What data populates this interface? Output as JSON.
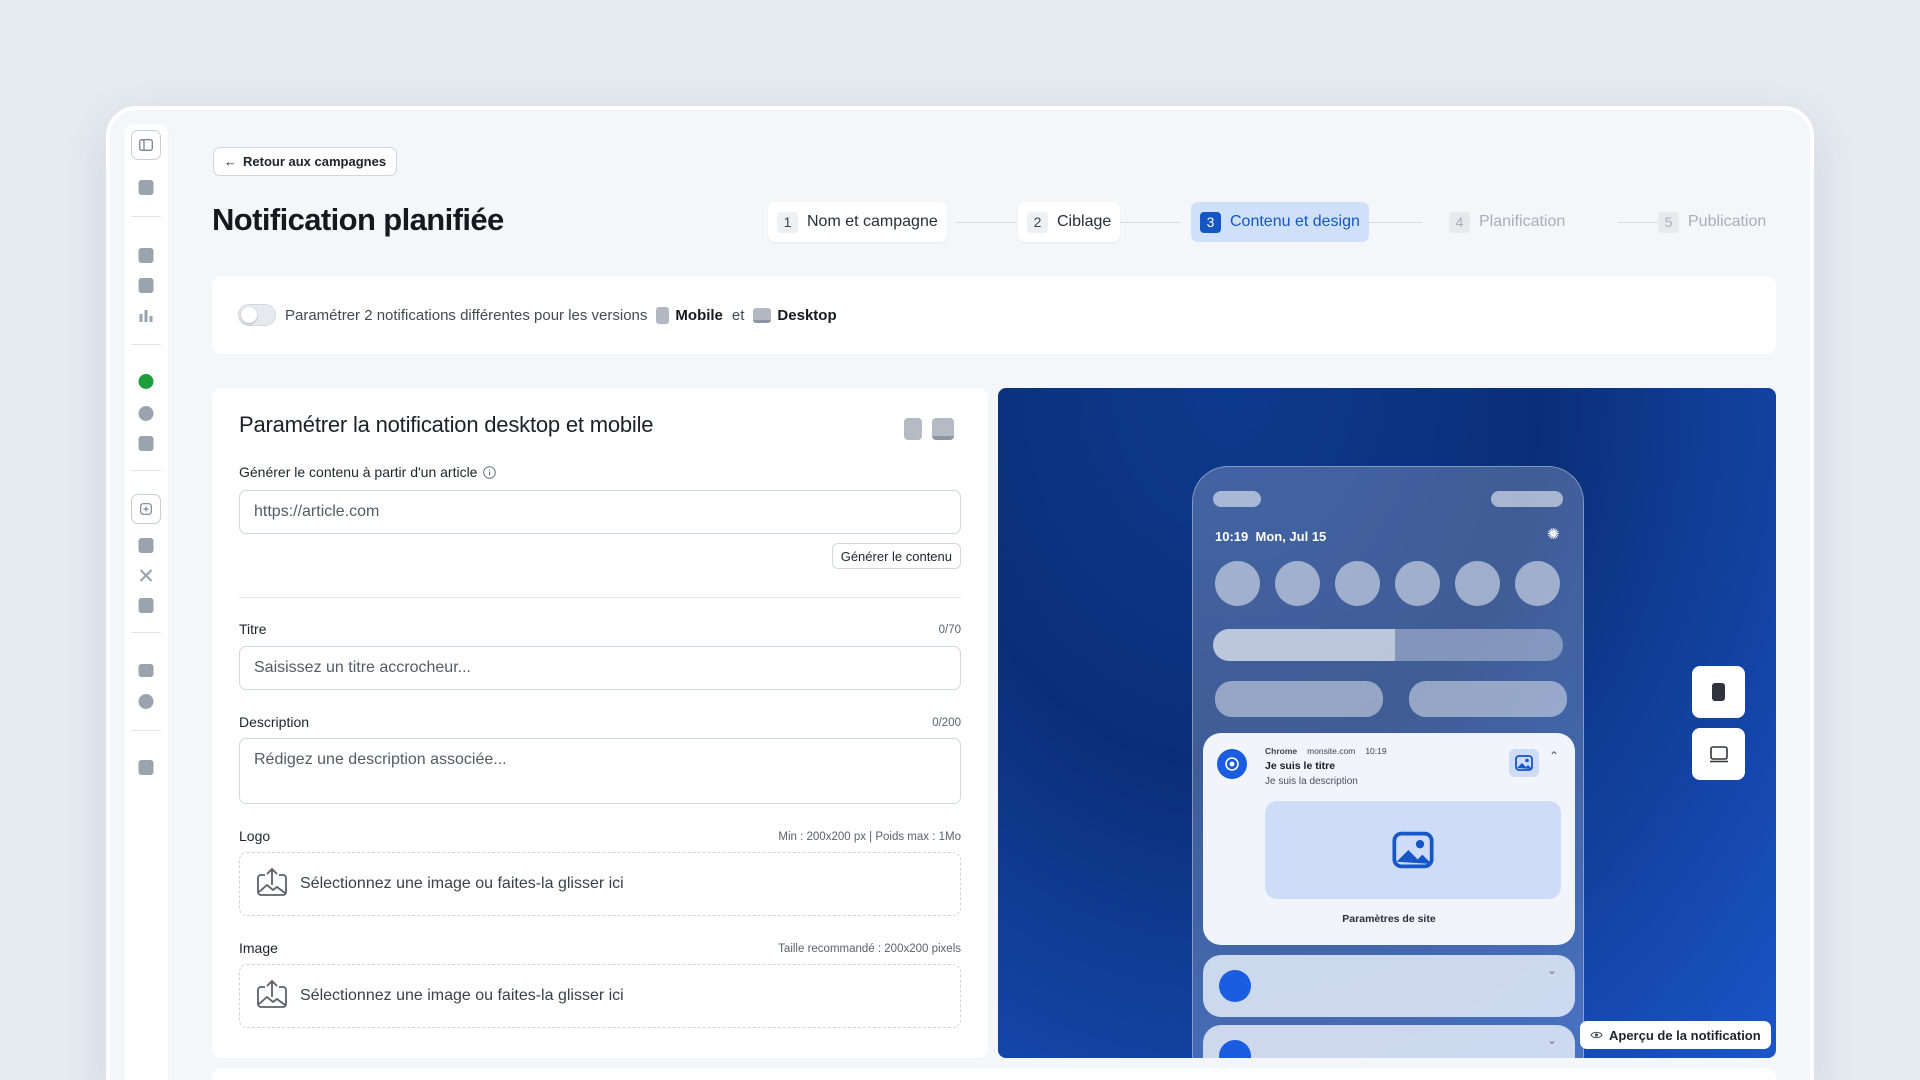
{
  "back_label": "Retour aux campagnes",
  "page_title": "Notification planifiée",
  "steps": [
    {
      "num": "1",
      "label": "Nom et campagne",
      "state": "done"
    },
    {
      "num": "2",
      "label": "Ciblage",
      "state": "done"
    },
    {
      "num": "3",
      "label": "Contenu et design",
      "state": "active"
    },
    {
      "num": "4",
      "label": "Planification",
      "state": "todo"
    },
    {
      "num": "5",
      "label": "Publication",
      "state": "todo"
    }
  ],
  "toggle": {
    "text": "Paramétrer 2 notifications différentes pour les versions",
    "mobile": "Mobile",
    "and": "et",
    "desktop": "Desktop",
    "on": false
  },
  "form": {
    "heading": "Paramétrer la notification desktop et mobile",
    "generate": {
      "label": "Générer le contenu à partir d'un article",
      "value": "https://article.com",
      "button": "Générer le contenu"
    },
    "title": {
      "label": "Titre",
      "counter": "0/70",
      "placeholder": "Saisissez un titre accrocheur..."
    },
    "description": {
      "label": "Description",
      "counter": "0/200",
      "placeholder": "Rédigez une description associée..."
    },
    "logo": {
      "label": "Logo",
      "hint": "Min : 200x200 px | Poids max : 1Mo",
      "drop": "Sélectionnez une image ou faites-la glisser ici"
    },
    "image": {
      "label": "Image",
      "hint": "Taille recommandé : 200x200 pixels",
      "drop": "Sélectionnez une image ou faites-la glisser ici"
    }
  },
  "preview": {
    "time": "10:19",
    "date": "Mon, Jul 15",
    "notification": {
      "app": "Chrome",
      "site": "monsite.com",
      "time": "10:19",
      "title": "Je suis le titre",
      "description": "Je suis la description",
      "settings": "Paramètres de site"
    },
    "apercu_label": "Aperçu de la notification"
  },
  "colors": {
    "accent": "#1556c4",
    "active_step_bg": "#cfe0fb",
    "status_green": "#1e9e3a"
  }
}
